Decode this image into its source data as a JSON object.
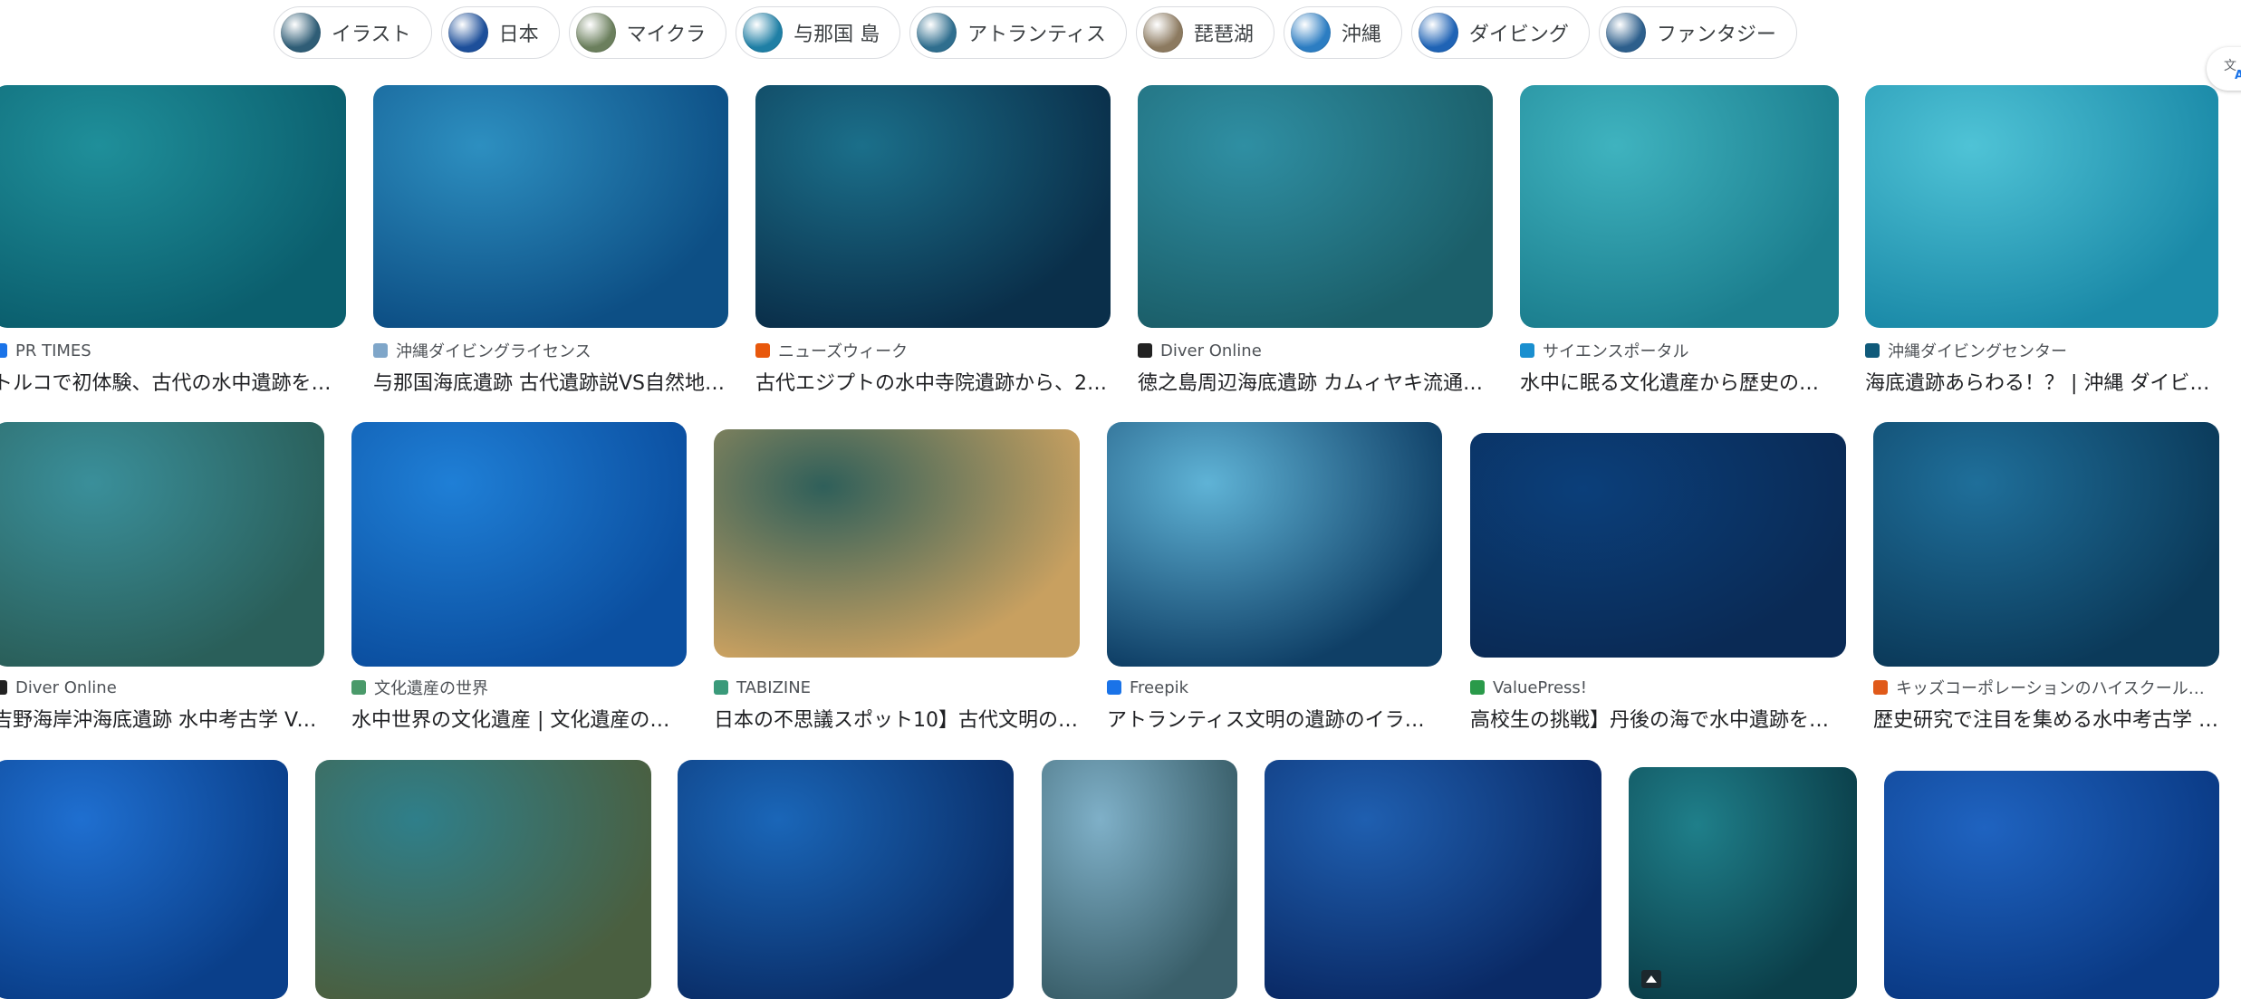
{
  "chips": [
    {
      "label": "イラスト",
      "icon": "illustration-thumb-icon",
      "color": "#2f5d76"
    },
    {
      "label": "日本",
      "icon": "japan-thumb-icon",
      "color": "#1d4f9a"
    },
    {
      "label": "マイクラ",
      "icon": "minecraft-thumb-icon",
      "color": "#6b7f5d"
    },
    {
      "label": "与那国 島",
      "icon": "yonaguni-thumb-icon",
      "color": "#1f7fa5"
    },
    {
      "label": "アトランティス",
      "icon": "atlantis-thumb-icon",
      "color": "#2f6e8e"
    },
    {
      "label": "琵琶湖",
      "icon": "biwako-thumb-icon",
      "color": "#8c7a60"
    },
    {
      "label": "沖縄",
      "icon": "okinawa-thumb-icon",
      "color": "#2c7dc2"
    },
    {
      "label": "ダイビング",
      "icon": "diving-thumb-icon",
      "color": "#1f63b5"
    },
    {
      "label": "ファンタジー",
      "icon": "fantasy-thumb-icon",
      "color": "#2d5f8c"
    }
  ],
  "translate": {
    "icon": "translate-icon"
  },
  "results": [
    {
      "source": "PR TIMES",
      "title": "トルコで初体験、古代の水中遺跡を…",
      "colors": [
        "#1f8f9a",
        "#0b5f6e"
      ],
      "fav": "#1a73e8"
    },
    {
      "source": "沖縄ダイビングライセンス",
      "title": "与那国海底遺跡 古代遺跡説VS自然地…",
      "colors": [
        "#2d8fc0",
        "#0d4f85"
      ],
      "fav": "#7fa6c9"
    },
    {
      "source": "ニューズウィーク",
      "title": "古代エジプトの水中寺院遺跡から、2…",
      "colors": [
        "#1b6f8a",
        "#0a2f4a"
      ],
      "fav": "#e8580c"
    },
    {
      "source": "Diver Online",
      "title": "徳之島周辺海底遺跡 カムィヤキ流通…",
      "colors": [
        "#2f8fa3",
        "#1b5f6a"
      ],
      "fav": "#222222"
    },
    {
      "source": "サイエンスポータル",
      "title": "水中に眠る文化遺産から歴史の…",
      "colors": [
        "#3fb3bf",
        "#1c7f8f"
      ],
      "fav": "#1a8fcf"
    },
    {
      "source": "沖縄ダイビングセンター",
      "title": "海底遺跡あらわる！？ | 沖縄 ダイビ…",
      "colors": [
        "#4fc3d6",
        "#1b8aa8"
      ],
      "fav": "#0f5a7a"
    },
    {
      "source": "Diver Online",
      "title": "吉野海岸沖海底遺跡 水中考古学 Vo…",
      "colors": [
        "#3a8f9a",
        "#2a5f5a"
      ],
      "fav": "#222222"
    },
    {
      "source": "文化遺産の世界",
      "title": "水中世界の文化遺産 | 文化遺産の…",
      "colors": [
        "#1f7fd6",
        "#0b4fa0"
      ],
      "fav": "#4a9a6a"
    },
    {
      "source": "TABIZINE",
      "title": "日本の不思議スポット10】古代文明の…",
      "colors": [
        "#2f5f5a",
        "#c8a060"
      ],
      "fav": "#3a9a7a"
    },
    {
      "source": "Freepik",
      "title": "アトランティス文明の遺跡のイラ…",
      "colors": [
        "#5fb3d6",
        "#0f3f66"
      ],
      "fav": "#1a73e8"
    },
    {
      "source": "ValuePress!",
      "title": "高校生の挑戦】丹後の海で水中遺跡を…",
      "colors": [
        "#0b3f7a",
        "#0a2a55"
      ],
      "fav": "#2a9a4a"
    },
    {
      "source": "キッズコーポレーションのハイスクール…",
      "title": "歴史研究で注目を集める水中考古学 …",
      "colors": [
        "#1f6f9a",
        "#0b3a5a"
      ],
      "fav": "#e05a1a"
    },
    {
      "source": "",
      "title": "",
      "colors": [
        "#1f6fd0",
        "#0a3f8a"
      ],
      "fav": ""
    },
    {
      "source": "",
      "title": "",
      "colors": [
        "#2f7f8a",
        "#4a5f40"
      ],
      "fav": ""
    },
    {
      "source": "",
      "title": "",
      "colors": [
        "#1a66b8",
        "#0a2f6a"
      ],
      "fav": ""
    },
    {
      "source": "",
      "title": "",
      "colors": [
        "#7fb0c8",
        "#3a5f6a"
      ],
      "fav": ""
    },
    {
      "source": "",
      "title": "",
      "colors": [
        "#1f5fb0",
        "#0a2a66"
      ],
      "fav": ""
    },
    {
      "source": "",
      "title": "",
      "colors": [
        "#1f7f8a",
        "#0b3f4a"
      ],
      "fav": ""
    },
    {
      "source": "",
      "title": "",
      "colors": [
        "#1f63c0",
        "#0a3a85"
      ],
      "fav": ""
    }
  ]
}
